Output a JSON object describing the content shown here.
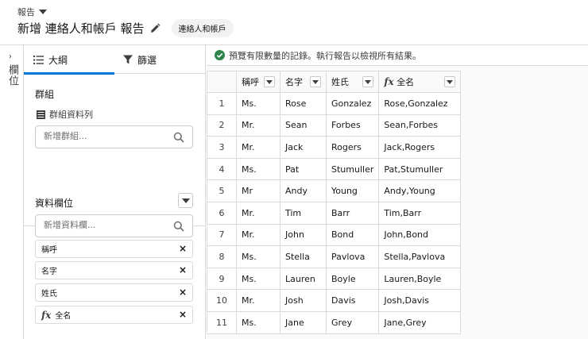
{
  "header": {
    "breadcrumb": "報告",
    "title": "新增 連絡人和帳戶 報告",
    "type_badge": "連絡人和帳戶"
  },
  "side_strip": {
    "label": "欄位"
  },
  "panel": {
    "tabs": {
      "outline": "大綱",
      "filter": "篩選"
    },
    "groups": {
      "title": "群組",
      "group_columns_label": "群組資料列",
      "group_input_placeholder": "新增群組..."
    },
    "fields": {
      "title": "資料欄位",
      "input_placeholder": "新增資料欄...",
      "items": [
        {
          "label": "稱呼",
          "icon": ""
        },
        {
          "label": "名字",
          "icon": ""
        },
        {
          "label": "姓氏",
          "icon": ""
        },
        {
          "label": "全名",
          "icon": "formula-icon"
        }
      ],
      "remove_symbol": "×"
    }
  },
  "banner": {
    "message": "預覽有限數量的記錄。執行報告以檢視所有結果。"
  },
  "table": {
    "columns": [
      "稱呼",
      "名字",
      "姓氏",
      "全名"
    ],
    "formula_prefix": "fx",
    "rows": [
      {
        "num": "1",
        "cells": [
          "Ms.",
          "Rose",
          "Gonzalez",
          "Rose,Gonzalez"
        ]
      },
      {
        "num": "2",
        "cells": [
          "Mr.",
          "Sean",
          "Forbes",
          "Sean,Forbes"
        ]
      },
      {
        "num": "3",
        "cells": [
          "Mr.",
          "Jack",
          "Rogers",
          "Jack,Rogers"
        ]
      },
      {
        "num": "4",
        "cells": [
          "Ms.",
          "Pat",
          "Stumuller",
          "Pat,Stumuller"
        ]
      },
      {
        "num": "5",
        "cells": [
          "Mr",
          "Andy",
          "Young",
          "Andy,Young"
        ]
      },
      {
        "num": "6",
        "cells": [
          "Mr.",
          "Tim",
          "Barr",
          "Tim,Barr"
        ]
      },
      {
        "num": "7",
        "cells": [
          "Mr.",
          "John",
          "Bond",
          "John,Bond"
        ]
      },
      {
        "num": "8",
        "cells": [
          "Ms.",
          "Stella",
          "Pavlova",
          "Stella,Pavlova"
        ]
      },
      {
        "num": "9",
        "cells": [
          "Ms.",
          "Lauren",
          "Boyle",
          "Lauren,Boyle"
        ]
      },
      {
        "num": "10",
        "cells": [
          "Mr.",
          "Josh",
          "Davis",
          "Josh,Davis"
        ]
      },
      {
        "num": "11",
        "cells": [
          "Ms.",
          "Jane",
          "Grey",
          "Jane,Grey"
        ]
      }
    ]
  },
  "colors": {
    "accent": "#0176d3",
    "success": "#2e844a",
    "border": "#dddbda"
  }
}
